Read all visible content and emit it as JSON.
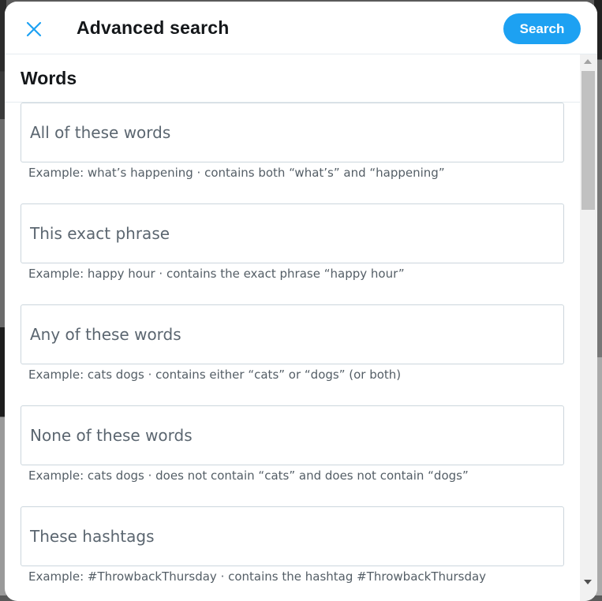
{
  "modal": {
    "title": "Advanced search",
    "close_icon": "close-icon",
    "search_label": "Search",
    "accent_color": "#1da1f2"
  },
  "words_section": {
    "heading": "Words",
    "fields": [
      {
        "placeholder": "All of these words",
        "value": "",
        "hint": "Example: what’s happening · contains both “what’s” and “happening”"
      },
      {
        "placeholder": "This exact phrase",
        "value": "",
        "hint": "Example: happy hour · contains the exact phrase “happy hour”"
      },
      {
        "placeholder": "Any of these words",
        "value": "",
        "hint": "Example: cats dogs · contains either “cats” or “dogs” (or both)"
      },
      {
        "placeholder": "None of these words",
        "value": "",
        "hint": "Example: cats dogs · does not contain “cats” and does not contain “dogs”"
      },
      {
        "placeholder": "These hashtags",
        "value": "",
        "hint": "Example: #ThrowbackThursday · contains the hashtag #ThrowbackThursday"
      }
    ]
  }
}
